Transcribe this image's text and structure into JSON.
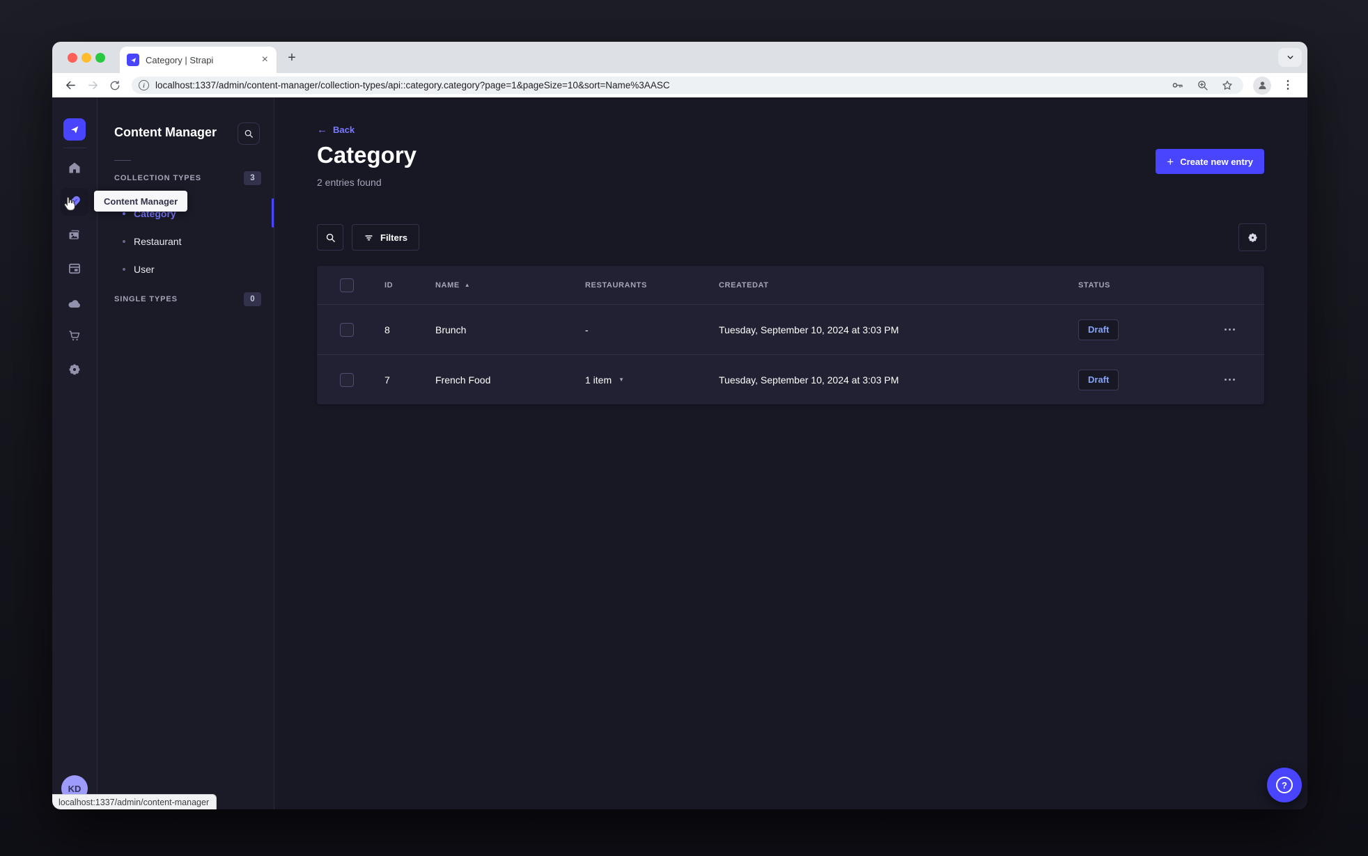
{
  "browser": {
    "tab_title": "Category | Strapi",
    "url": "localhost:1337/admin/content-manager/collection-types/api::category.category?page=1&pageSize=10&sort=Name%3AASC",
    "status_bar_url": "localhost:1337/admin/content-manager",
    "icons": [
      "close",
      "minimize",
      "maximize",
      "tab-close",
      "new-tab-plus",
      "tab-search-chevron",
      "back",
      "forward",
      "reload",
      "page-info",
      "password-key",
      "zoom-in",
      "bookmark-star",
      "profile",
      "menu-kebab"
    ]
  },
  "admin": {
    "tooltip": "Content Manager",
    "user_initials": "KD",
    "rail_icons": [
      "strapi-logo",
      "home",
      "content-manager",
      "media-library",
      "content-type-builder",
      "cloud",
      "marketplace",
      "settings"
    ],
    "subnav": {
      "title": "Content Manager",
      "sections": [
        {
          "label": "COLLECTION TYPES",
          "count": "3"
        },
        {
          "label": "SINGLE TYPES",
          "count": "0"
        }
      ],
      "items": [
        {
          "label": "Category",
          "active": true
        },
        {
          "label": "Restaurant",
          "active": false
        },
        {
          "label": "User",
          "active": false
        }
      ]
    },
    "header": {
      "back": "Back",
      "title": "Category",
      "subtitle": "2 entries found",
      "create_button": "Create new entry"
    },
    "filters_button": "Filters",
    "table": {
      "columns": [
        "ID",
        "NAME",
        "RESTAURANTS",
        "CREATEDAT",
        "STATUS"
      ],
      "rows": [
        {
          "id": "8",
          "name": "Brunch",
          "restaurants": "-",
          "created_at": "Tuesday, September 10, 2024 at 3:03 PM",
          "status": "Draft"
        },
        {
          "id": "7",
          "name": "French Food",
          "restaurants": "1 item",
          "created_at": "Tuesday, September 10, 2024 at 3:03 PM",
          "status": "Draft"
        }
      ]
    }
  },
  "colors": {
    "accent": "#4945ff",
    "accent_light": "#7b79ff",
    "draft_text": "#84a4f8",
    "traffic_red": "#ff5f57",
    "traffic_yellow": "#febc2e",
    "traffic_green": "#28c840"
  }
}
